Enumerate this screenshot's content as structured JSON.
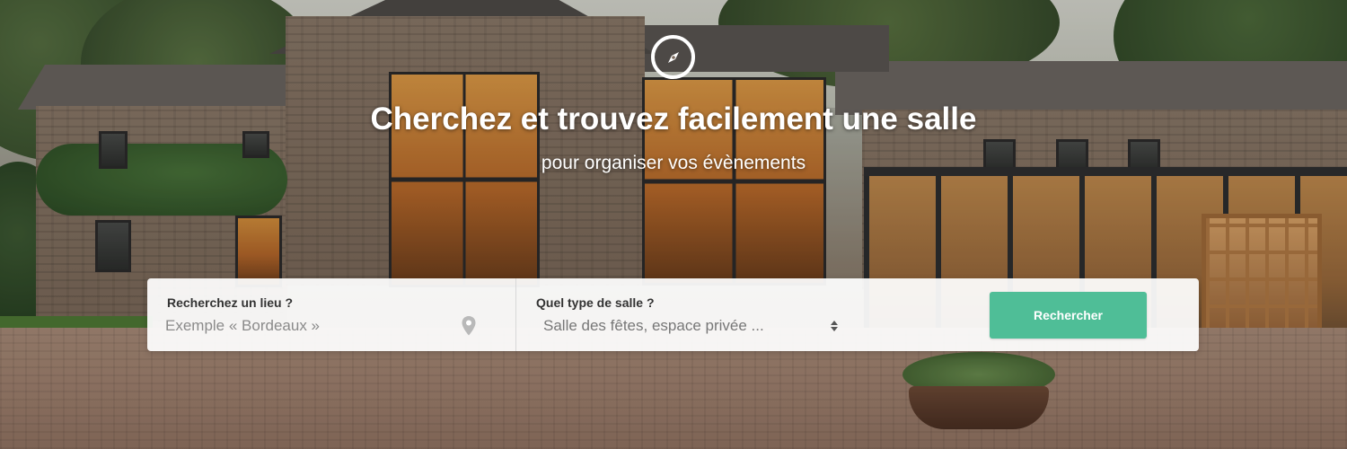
{
  "hero": {
    "icon": "compass-icon",
    "title": "Cherchez et trouvez facilement une salle",
    "subtitle": "pour organiser vos évènements"
  },
  "search": {
    "location": {
      "label": "Recherchez un lieu ?",
      "placeholder": "Exemple « Bordeaux »",
      "value": "",
      "icon": "map-pin-icon"
    },
    "venue_type": {
      "label": "Quel type de salle ?",
      "selected": "Salle des fêtes, espace privée ...",
      "icon": "sort-arrows-icon"
    },
    "button_label": "Rechercher"
  },
  "colors": {
    "accent": "#4fbe97",
    "text_white": "#ffffff",
    "label": "#333333",
    "placeholder": "#8a8a8a"
  }
}
